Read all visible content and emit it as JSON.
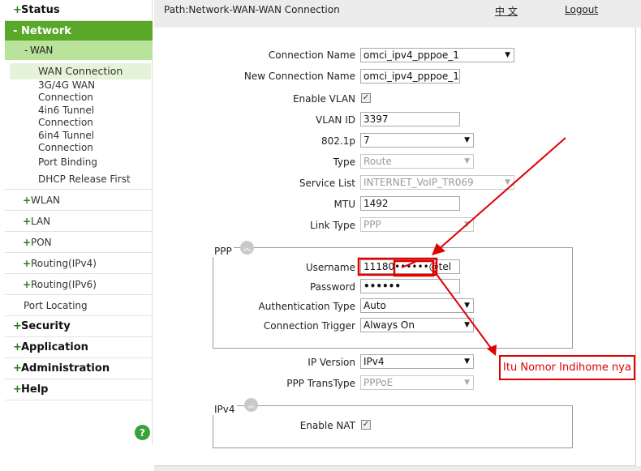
{
  "sidebar": {
    "status": "Status",
    "network": "Network",
    "wan": "WAN",
    "wan_items": [
      "WAN Connection",
      "3G/4G WAN\nConnection",
      "4in6 Tunnel\nConnection",
      "6in4 Tunnel\nConnection",
      "Port Binding",
      "DHCP Release First"
    ],
    "network_items": [
      "WLAN",
      "LAN",
      "PON",
      "Routing(IPv4)",
      "Routing(IPv6)",
      "Port Locating"
    ],
    "security": "Security",
    "application": "Application",
    "administration": "Administration",
    "help": "Help",
    "plus": "+",
    "minus": "-",
    "help_icon": "?"
  },
  "header": {
    "path": "Path:Network-WAN-WAN Connection",
    "lang": "中 文",
    "logout": "Logout"
  },
  "form": {
    "connection_name_label": "Connection Name",
    "connection_name_value": "omci_ipv4_pppoe_1",
    "new_connection_name_label": "New Connection Name",
    "new_connection_name_value": "omci_ipv4_pppoe_1",
    "enable_vlan_label": "Enable VLAN",
    "vlan_id_label": "VLAN ID",
    "vlan_id_value": "3397",
    "p8021_label": "802.1p",
    "p8021_value": "7",
    "type_label": "Type",
    "type_value": "Route",
    "service_list_label": "Service List",
    "service_list_value": "INTERNET_VoIP_TR069",
    "mtu_label": "MTU",
    "mtu_value": "1492",
    "link_type_label": "Link Type",
    "link_type_value": "PPP",
    "ppp_title": "PPP",
    "username_label": "Username",
    "username_value": "11180••••••@tel",
    "password_label": "Password",
    "password_value": "••••••",
    "auth_label": "Authentication Type",
    "auth_value": "Auto",
    "trigger_label": "Connection Trigger",
    "trigger_value": "Always On",
    "ip_version_label": "IP Version",
    "ip_version_value": "IPv4",
    "ppp_transtype_label": "PPP TransType",
    "ppp_transtype_value": "PPPoE",
    "ipv4_title": "IPv4",
    "enable_nat_label": "Enable NAT"
  },
  "annotation": {
    "text": "Itu Nomor Indihome nya",
    "color": "#e00000"
  },
  "colors": {
    "active_green": "#5aa82a",
    "wan_green": "#b9e29a",
    "selected_green": "#e5f4d9",
    "header_gray": "#ececec"
  }
}
